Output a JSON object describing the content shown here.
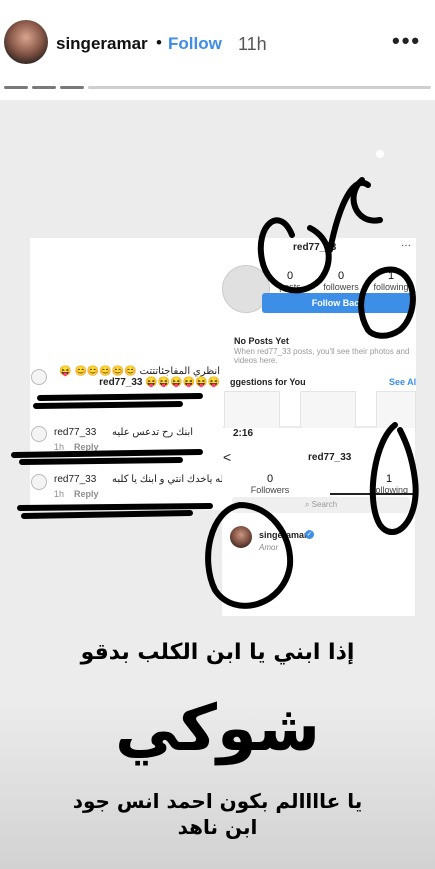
{
  "header": {
    "username": "singeramar",
    "separator": "•",
    "follow_label": "Follow",
    "time_ago": "11h",
    "more_icon": "•••",
    "progress_segments": 4,
    "progress_viewed": 3
  },
  "screenshot_left": {
    "comments": [
      {
        "user": "red77_33",
        "text": "انظري المفاجئاتتتت 😊😊😊😊😊 😝😝😝😝😝😝😝",
        "time": "",
        "reply": ""
      },
      {
        "user": "red77_33",
        "text": "ابنك رح تدعس عليه",
        "time": "1h",
        "reply": "Reply"
      },
      {
        "user": "red77_33",
        "text": "الله ياخدك انتي و ابنك يا كلبه",
        "time": "1h",
        "reply": "Reply"
      }
    ]
  },
  "screenshot_right": {
    "username": "red77_33",
    "more": "···",
    "stats": [
      {
        "num": "0",
        "label": "posts"
      },
      {
        "num": "0",
        "label": "followers"
      },
      {
        "num": "1",
        "label": "following"
      }
    ],
    "follow_back": "Follow Back",
    "no_posts_title": "No Posts Yet",
    "no_posts_sub": "When red77_33 posts, you'll see their photos and videos here.",
    "suggestions": "ggestions for You",
    "see_all": "See Al"
  },
  "screenshot_bottom": {
    "time": "2:16",
    "back_icon": "<",
    "username": "red77_33",
    "followers_num": "0",
    "followers_label": "Followers",
    "following_num": "1",
    "following_label": "Following",
    "search_placeholder": "Search",
    "account_name": "singeramar",
    "account_bio": "Amor"
  },
  "captions": {
    "line1": "إذا ابني يا ابن الكلب بدقو",
    "line2": "شوكي",
    "line3a": "يا عاااالم بكون احمد انس جود",
    "line3b": "ابن ناهد"
  },
  "colors": {
    "follow": "#3d8ee6",
    "ink": "#000000"
  }
}
